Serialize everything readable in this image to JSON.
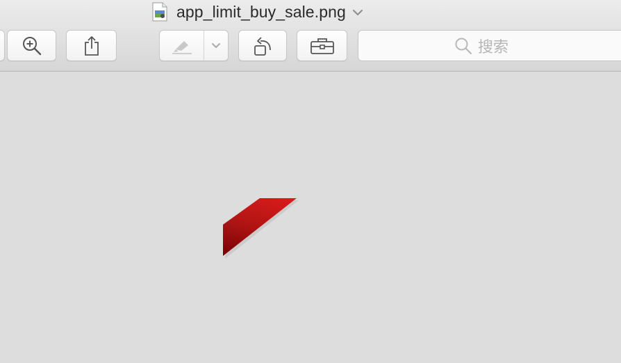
{
  "window": {
    "title": "app_limit_buy_sale.png"
  },
  "toolbar": {
    "buttons": [
      {
        "name": "zoom-in",
        "icon": "zoom-in-icon"
      },
      {
        "name": "share",
        "icon": "share-icon"
      },
      {
        "name": "markup",
        "icon": "markup-pen-icon"
      },
      {
        "name": "rotate",
        "icon": "rotate-left-icon"
      },
      {
        "name": "toolbox",
        "icon": "toolbox-icon"
      }
    ]
  },
  "search": {
    "placeholder": "搜索"
  },
  "colors": {
    "background": "#dddddd",
    "ribbon_light": "#d40000",
    "ribbon_dark": "#8c0000"
  }
}
